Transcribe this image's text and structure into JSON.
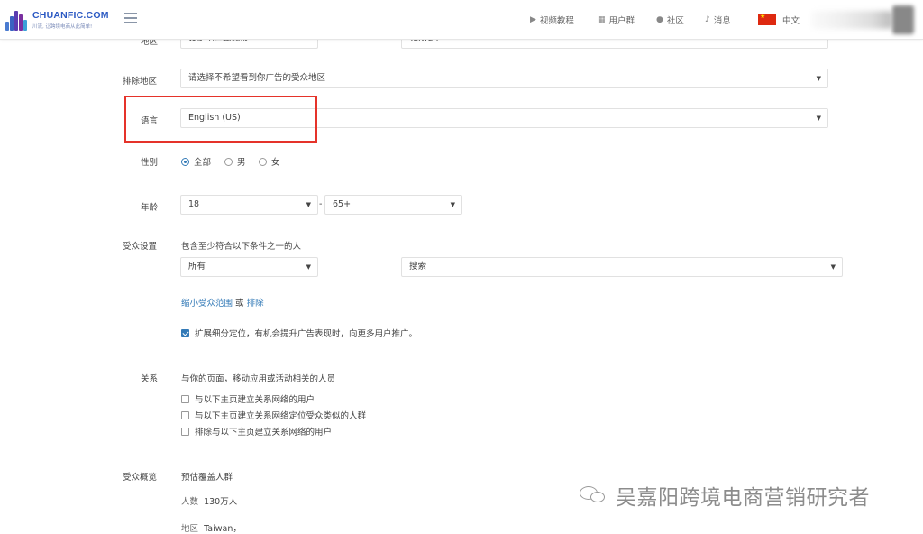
{
  "header": {
    "logo_name": "CHUANFIC.COM",
    "logo_slogan": "川流, 让跨境电商从此简单!",
    "nav": [
      {
        "icon": "play-circle-icon",
        "label": "视频教程"
      },
      {
        "icon": "grid-icon",
        "label": "用户群"
      },
      {
        "icon": "person-icon",
        "label": "社区"
      },
      {
        "icon": "bell-icon",
        "label": "消息"
      }
    ],
    "language": "中文"
  },
  "form": {
    "top_cut": {
      "label": "地区",
      "value_left": "设定地区或城市",
      "value_right": "Taiwan"
    },
    "exclude_region": {
      "label": "排除地区",
      "placeholder": "请选择不希望看到你广告的受众地区"
    },
    "language": {
      "label": "语言",
      "value": "English (US)"
    },
    "gender": {
      "label": "性别",
      "options": [
        "全部",
        "男",
        "女"
      ],
      "selected": "全部"
    },
    "age": {
      "label": "年龄",
      "min": "18",
      "separator": "-",
      "max": "65+"
    },
    "audience": {
      "label": "受众设置",
      "hint": "包含至少符合以下条件之一的人",
      "scope": "所有",
      "search_placeholder": "搜索",
      "narrow_link": "缩小受众范围",
      "or_text": "或",
      "exclude_link": "排除",
      "expand_text": "扩展细分定位，有机会提升广告表现时，向更多用户推广。"
    },
    "connections": {
      "label": "关系",
      "hint": "与你的页面，移动应用或活动相关的人员",
      "options": [
        "与以下主页建立关系网络的用户",
        "与以下主页建立关系网络定位受众类似的人群",
        "排除与以下主页建立关系网络的用户"
      ]
    },
    "overview": {
      "label": "受众概览",
      "title": "预估覆盖人群",
      "people_label": "人数",
      "people_value": "130万人",
      "region_label": "地区",
      "region_value": "Taiwan，"
    }
  },
  "watermark": "吴嘉阳跨境电商营销研究者",
  "colors": {
    "accent": "#337ab7",
    "highlight": "#e5332a",
    "logo": "#2b59c3"
  }
}
